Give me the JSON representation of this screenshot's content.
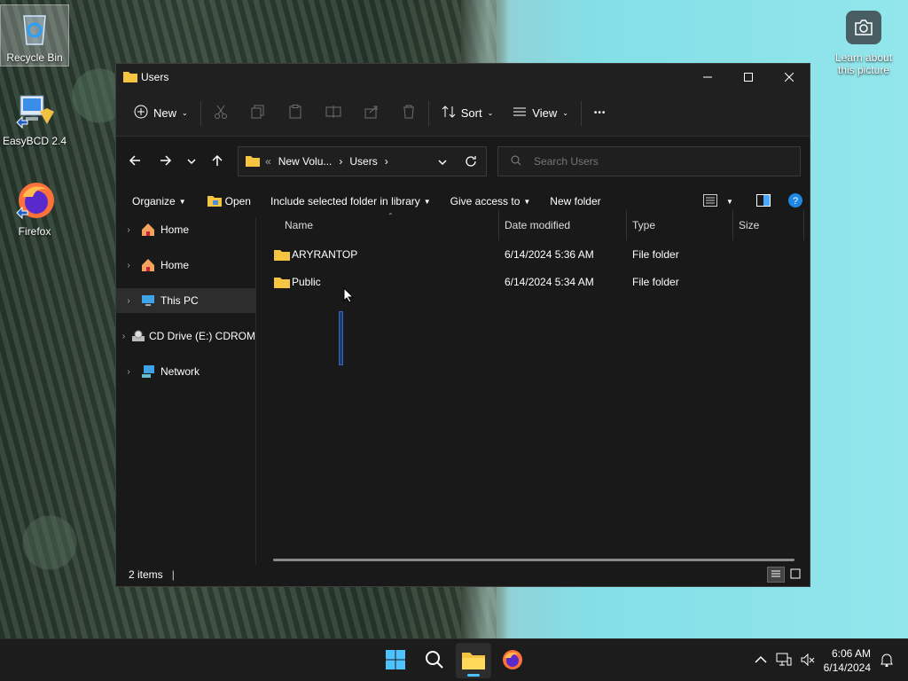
{
  "desktop": {
    "icons": [
      {
        "label": "Recycle Bin"
      },
      {
        "label": "EasyBCD 2.4"
      },
      {
        "label": "Firefox"
      }
    ],
    "learn_label": "Learn about this picture"
  },
  "window": {
    "title": "Users",
    "commands": {
      "new": "New",
      "sort": "Sort",
      "view": "View",
      "more": "•••"
    },
    "address": {
      "overflow": "«",
      "segments": [
        "New Volu...",
        "Users"
      ]
    },
    "search_placeholder": "Search Users",
    "toolbar2": {
      "organize": "Organize",
      "open": "Open",
      "include": "Include selected folder in library",
      "give_access": "Give access to",
      "new_folder": "New folder"
    },
    "nav": [
      {
        "label": "Home"
      },
      {
        "label": "Home"
      },
      {
        "label": "This PC"
      },
      {
        "label": "CD Drive (E:) CDROM"
      },
      {
        "label": "Network"
      }
    ],
    "columns": [
      "Name",
      "Date modified",
      "Type",
      "Size"
    ],
    "rows": [
      {
        "name": "ARYRANTOP",
        "date": "6/14/2024 5:36 AM",
        "type": "File folder",
        "size": ""
      },
      {
        "name": "Public",
        "date": "6/14/2024 5:34 AM",
        "type": "File folder",
        "size": ""
      }
    ],
    "status": "2 items"
  },
  "taskbar": {
    "time": "6:06 AM",
    "date": "6/14/2024"
  },
  "colors": {
    "accent": "#4cc2ff",
    "folder": "#f5c542"
  }
}
